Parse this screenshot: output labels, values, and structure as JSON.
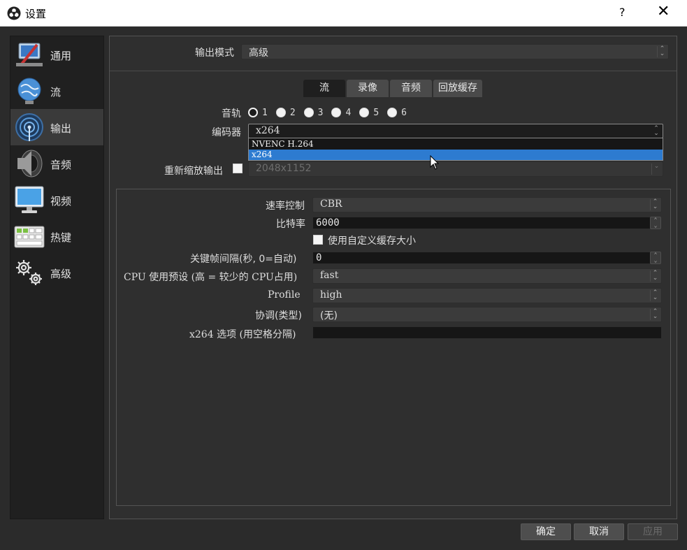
{
  "window": {
    "title": "设置",
    "help_label": "?",
    "close_label": "✕"
  },
  "sidebar": {
    "items": [
      {
        "label": "通用",
        "icon": "general-icon"
      },
      {
        "label": "流",
        "icon": "stream-icon"
      },
      {
        "label": "输出",
        "icon": "output-icon",
        "active": true
      },
      {
        "label": "音频",
        "icon": "audio-icon"
      },
      {
        "label": "视频",
        "icon": "video-icon"
      },
      {
        "label": "热键",
        "icon": "hotkeys-icon"
      },
      {
        "label": "高级",
        "icon": "advanced-icon"
      }
    ]
  },
  "output_mode": {
    "label": "输出模式",
    "value": "高级"
  },
  "tabs": [
    {
      "label": "流",
      "active": true
    },
    {
      "label": "录像"
    },
    {
      "label": "音频"
    },
    {
      "label": "回放缓存"
    }
  ],
  "audio_track": {
    "label": "音轨",
    "options": [
      "1",
      "2",
      "3",
      "4",
      "5",
      "6"
    ],
    "selected": "1"
  },
  "encoder": {
    "label": "编码器",
    "value": "x264",
    "options": [
      "NVENC H.264",
      "x264"
    ],
    "highlighted": "x264"
  },
  "rescale": {
    "label": "重新缩放输出",
    "checked": false,
    "value": "2048x1152"
  },
  "settings": {
    "rate_control": {
      "label": "速率控制",
      "value": "CBR"
    },
    "bitrate": {
      "label": "比特率",
      "value": "6000"
    },
    "custom_buffer": {
      "label": "使用自定义缓存大小",
      "checked": false
    },
    "keyframe": {
      "label": "关键帧间隔(秒, 0=自动)",
      "value": "0"
    },
    "cpu_preset": {
      "label": "CPU 使用预设 (高 = 较少的 CPU占用)",
      "value": "fast"
    },
    "profile": {
      "label": "Profile",
      "value": "high"
    },
    "tune": {
      "label": "协调(类型)",
      "value": "(无)"
    },
    "x264_opts": {
      "label": "x264 选项 (用空格分隔)",
      "value": ""
    }
  },
  "buttons": {
    "ok": "确定",
    "cancel": "取消",
    "apply": "应用"
  },
  "colors": {
    "accent": "#2d7bd0",
    "background": "#2b2b2b",
    "sidebar": "#202020"
  }
}
